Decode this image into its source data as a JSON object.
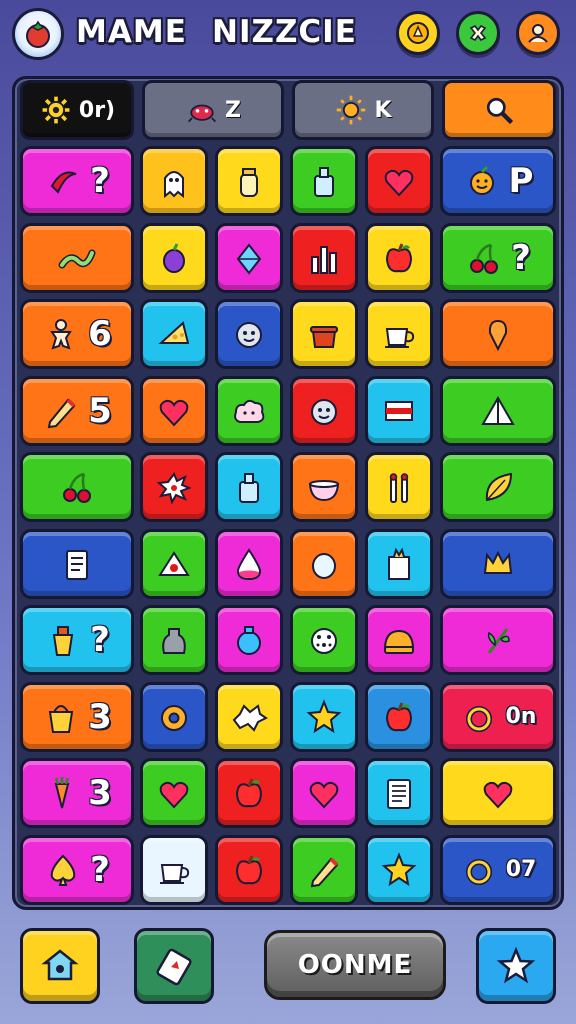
{
  "header": {
    "title_left": "MAME",
    "title_right": "NIZZCIE",
    "logo_icon": "tomato-logo-icon",
    "top_buttons": [
      {
        "name": "gold-coin-button",
        "icon": "coin-icon",
        "color": "#ffd21f"
      },
      {
        "name": "green-badge-button",
        "icon": "cross-badge-icon",
        "color": "#3cc83c"
      },
      {
        "name": "orange-profile-button",
        "icon": "profile-icon",
        "color": "#ff8a1e"
      }
    ]
  },
  "board_header": [
    {
      "label": "0r)",
      "icon": "gear-icon",
      "color": "#111111"
    },
    {
      "label": "Z",
      "icon": "bug-icon",
      "color": "#6a6f86"
    },
    {
      "label": "K",
      "icon": "sun-icon",
      "color": "#6a6f86"
    },
    {
      "label": "",
      "icon": "magnifier-icon",
      "color": "#ff8c1a"
    }
  ],
  "colors": {
    "magenta": "#ee2bd6",
    "orange": "#ff7416",
    "yellow": "#ffd91c",
    "green": "#3ccc22",
    "red": "#ee2020",
    "blue": "#2b56c8",
    "cyan": "#22c2ee",
    "lime": "#54d428",
    "white": "#e9f6ff"
  },
  "grid": [
    [
      {
        "icon": "chili-icon",
        "label": "?",
        "color": "#ee2bd6"
      },
      {
        "icon": "ghost-icon",
        "label": "",
        "color": "#ffc21c"
      },
      {
        "icon": "jar-icon",
        "label": "",
        "color": "#ffd91c"
      },
      {
        "icon": "bottle-icon",
        "label": "",
        "color": "#3ccc22"
      },
      {
        "icon": "heart-icon",
        "label": "",
        "color": "#ee2020"
      },
      {
        "icon": "smiley-fruit-icon",
        "label": "P",
        "color": "#2b56c8"
      }
    ],
    [
      {
        "icon": "worm-icon",
        "label": "",
        "color": "#ff7416"
      },
      {
        "icon": "plum-icon",
        "label": "",
        "color": "#ffd91c"
      },
      {
        "icon": "gem-icon",
        "label": "",
        "color": "#ee2bd6"
      },
      {
        "icon": "chart-icon",
        "label": "",
        "color": "#ee2020"
      },
      {
        "icon": "apple-icon",
        "label": "",
        "color": "#ffd91c"
      },
      {
        "icon": "cherries-icon",
        "label": "?",
        "color": "#3ccc22"
      }
    ],
    [
      {
        "icon": "gingerbread-icon",
        "label": "6",
        "color": "#ff7416"
      },
      {
        "icon": "cheese-icon",
        "label": "",
        "color": "#22c2ee"
      },
      {
        "icon": "face-icon",
        "label": "",
        "color": "#2b56c8"
      },
      {
        "icon": "pot-icon",
        "label": "",
        "color": "#ffd91c"
      },
      {
        "icon": "teacup-icon",
        "label": "",
        "color": "#ffd91c"
      },
      {
        "icon": "pin-icon",
        "label": "",
        "color": "#ff7416"
      }
    ],
    [
      {
        "icon": "pencil-icon",
        "label": "5",
        "color": "#ff7416"
      },
      {
        "icon": "heart-icon",
        "label": "",
        "color": "#ff7416"
      },
      {
        "icon": "cloud-icon",
        "label": "",
        "color": "#3ccc22"
      },
      {
        "icon": "face-icon",
        "label": "",
        "color": "#ee2020"
      },
      {
        "icon": "flag-icon",
        "label": "",
        "color": "#22c2ee"
      },
      {
        "icon": "tent-icon",
        "label": "",
        "color": "#3ccc22"
      }
    ],
    [
      {
        "icon": "cherries-icon",
        "label": "",
        "color": "#3ccc22"
      },
      {
        "icon": "splat-icon",
        "label": "",
        "color": "#ee2020"
      },
      {
        "icon": "bottle-icon",
        "label": "",
        "color": "#22c2ee"
      },
      {
        "icon": "bowl-icon",
        "label": "",
        "color": "#ff7416"
      },
      {
        "icon": "sticks-icon",
        "label": "",
        "color": "#ffd91c"
      },
      {
        "icon": "leaf-icon",
        "label": "",
        "color": "#3ccc22"
      }
    ],
    [
      {
        "icon": "book-icon",
        "label": "",
        "color": "#2b56c8"
      },
      {
        "icon": "cake-icon",
        "label": "",
        "color": "#3ccc22"
      },
      {
        "icon": "drop-icon",
        "label": "",
        "color": "#ee2bd6"
      },
      {
        "icon": "egg-icon",
        "label": "",
        "color": "#ff7416"
      },
      {
        "icon": "box-icon",
        "label": "",
        "color": "#22c2ee"
      },
      {
        "icon": "crown-icon",
        "label": "",
        "color": "#2b56c8"
      }
    ],
    [
      {
        "icon": "cup-icon",
        "label": "?",
        "color": "#22c2ee"
      },
      {
        "icon": "bag-icon",
        "label": "",
        "color": "#3ccc22"
      },
      {
        "icon": "ornament-icon",
        "label": "",
        "color": "#ee2bd6"
      },
      {
        "icon": "ball-icon",
        "label": "",
        "color": "#3ccc22"
      },
      {
        "icon": "bun-icon",
        "label": "",
        "color": "#ee2bd6"
      },
      {
        "icon": "herb-icon",
        "label": "",
        "color": "#ee2bd6"
      }
    ],
    [
      {
        "icon": "bucket-icon",
        "label": "3",
        "color": "#ff7416"
      },
      {
        "icon": "donut-icon",
        "label": "",
        "color": "#2b56c8"
      },
      {
        "icon": "star-burst-icon",
        "label": "",
        "color": "#ffd91c"
      },
      {
        "icon": "star-icon",
        "label": "",
        "color": "#22c2ee"
      },
      {
        "icon": "apple-icon",
        "label": "",
        "color": "#2b90e0"
      },
      {
        "icon": "ring-icon",
        "label": "0n",
        "color": "#ee2050"
      }
    ],
    [
      {
        "icon": "carrot-icon",
        "label": "3",
        "color": "#ee2bd6"
      },
      {
        "icon": "heart-icon",
        "label": "",
        "color": "#3ccc22"
      },
      {
        "icon": "apple-icon",
        "label": "",
        "color": "#ee2020"
      },
      {
        "icon": "heart-icon",
        "label": "",
        "color": "#ee2bd6"
      },
      {
        "icon": "note-icon",
        "label": "",
        "color": "#22c2ee"
      },
      {
        "icon": "heart-icon",
        "label": "",
        "color": "#ffd91c"
      }
    ],
    [
      {
        "icon": "spade-icon",
        "label": "?",
        "color": "#ee2bd6"
      },
      {
        "icon": "teacup-icon",
        "label": "",
        "color": "#e9f6ff"
      },
      {
        "icon": "apple-icon",
        "label": "",
        "color": "#ee2020"
      },
      {
        "icon": "pencil-icon",
        "label": "",
        "color": "#3ccc22"
      },
      {
        "icon": "star-icon",
        "label": "",
        "color": "#22c2ee"
      },
      {
        "icon": "ring-icon",
        "label": "07",
        "color": "#2b56c8"
      }
    ]
  ],
  "footer": {
    "left_button_icon": "house-icon",
    "left_button_color": "#ffd21f",
    "card_button_icon": "card-icon",
    "card_button_color": "#2f8f5a",
    "main_button_label": "OONME",
    "right_button_icon": "star-icon",
    "right_button_color": "#2aa8f0"
  }
}
